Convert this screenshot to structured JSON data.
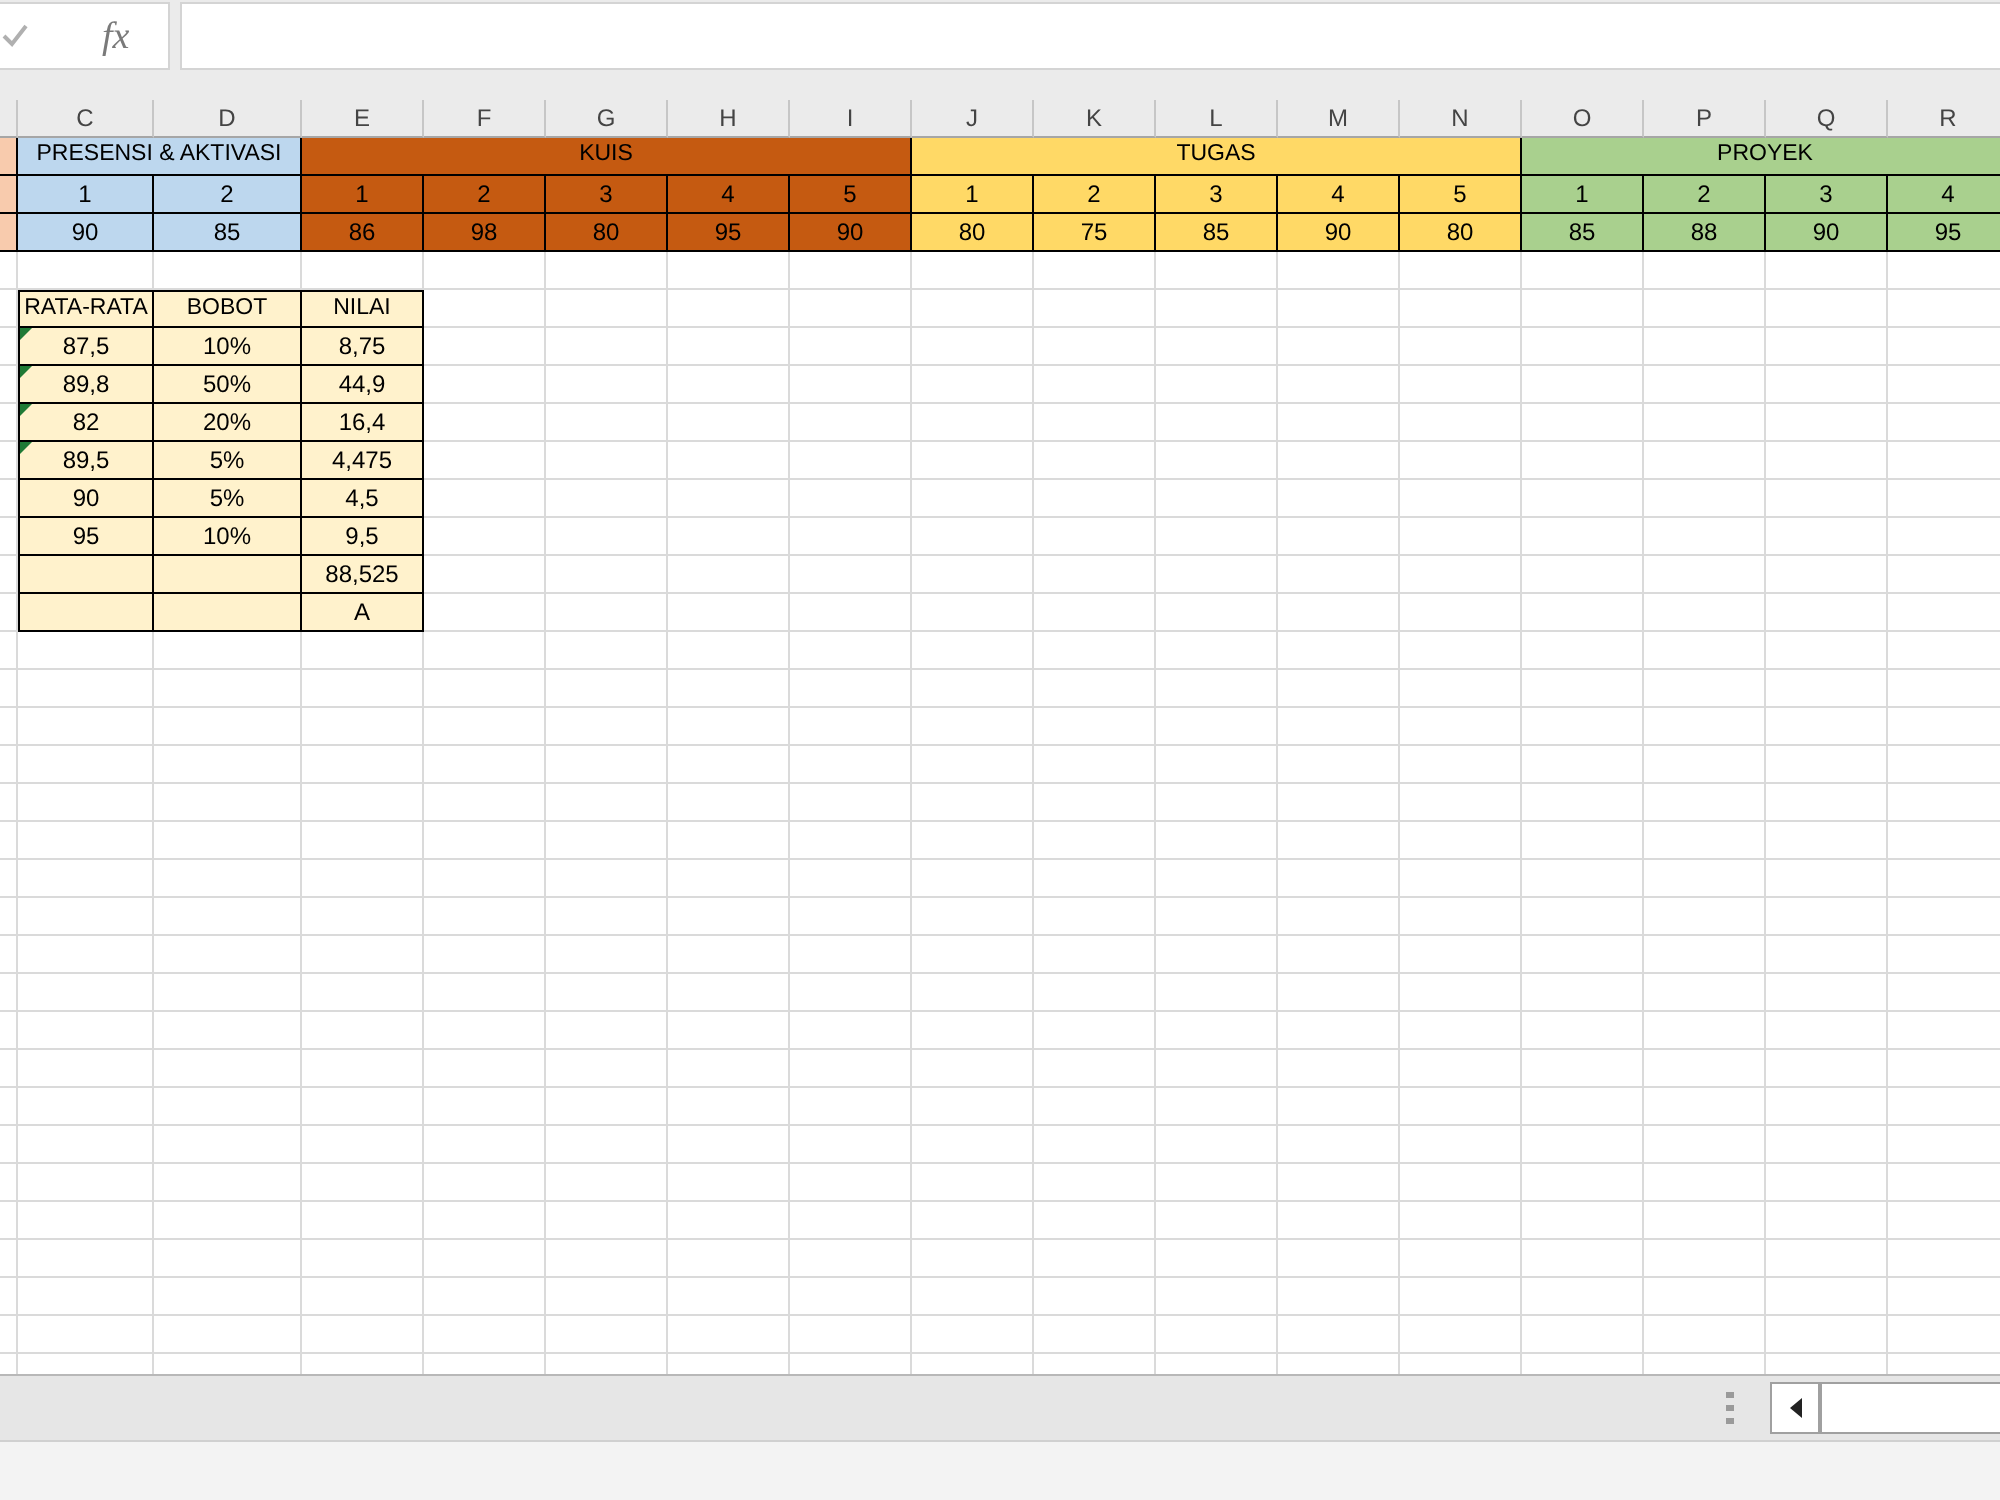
{
  "formula_bar": {
    "function_button": "fx"
  },
  "column_headers": [
    "C",
    "D",
    "E",
    "F",
    "G",
    "H",
    "I",
    "J",
    "K",
    "L",
    "M",
    "N",
    "O",
    "P",
    "Q",
    "R"
  ],
  "score_groups": [
    {
      "kind": "partial",
      "color": "#f8cbad"
    },
    {
      "kind": "full",
      "label": "PRESENSI & AKTIVASI",
      "color": "#bdd7ee",
      "items": [
        {
          "number": "1",
          "score": "90"
        },
        {
          "number": "2",
          "score": "85"
        }
      ]
    },
    {
      "kind": "full",
      "label": "KUIS",
      "color": "#c55a11",
      "items": [
        {
          "number": "1",
          "score": "86"
        },
        {
          "number": "2",
          "score": "98"
        },
        {
          "number": "3",
          "score": "80"
        },
        {
          "number": "4",
          "score": "95"
        },
        {
          "number": "5",
          "score": "90"
        }
      ]
    },
    {
      "kind": "full",
      "label": "TUGAS",
      "color": "#ffd966",
      "items": [
        {
          "number": "1",
          "score": "80"
        },
        {
          "number": "2",
          "score": "75"
        },
        {
          "number": "3",
          "score": "85"
        },
        {
          "number": "4",
          "score": "90"
        },
        {
          "number": "5",
          "score": "80"
        }
      ]
    },
    {
      "kind": "full",
      "label": "PROYEK",
      "color": "#a9d08e",
      "items": [
        {
          "number": "1",
          "score": "85"
        },
        {
          "number": "2",
          "score": "88"
        },
        {
          "number": "3",
          "score": "90"
        },
        {
          "number": "4",
          "score": "95"
        }
      ]
    }
  ],
  "summary_table": {
    "headers": [
      "RATA-RATA",
      "BOBOT",
      "NILAI"
    ],
    "rows": [
      {
        "average": "87,5",
        "weight": "10%",
        "value": "8,75",
        "flagged": true
      },
      {
        "average": "89,8",
        "weight": "50%",
        "value": "44,9",
        "flagged": true
      },
      {
        "average": "82",
        "weight": "20%",
        "value": "16,4",
        "flagged": true
      },
      {
        "average": "89,5",
        "weight": "5%",
        "value": "4,475",
        "flagged": true
      },
      {
        "average": "90",
        "weight": "5%",
        "value": "4,5",
        "flagged": false
      },
      {
        "average": "95",
        "weight": "10%",
        "value": "9,5",
        "flagged": false
      },
      {
        "value": "88,525",
        "flagged": false
      },
      {
        "value": "A",
        "flagged": false
      }
    ]
  }
}
